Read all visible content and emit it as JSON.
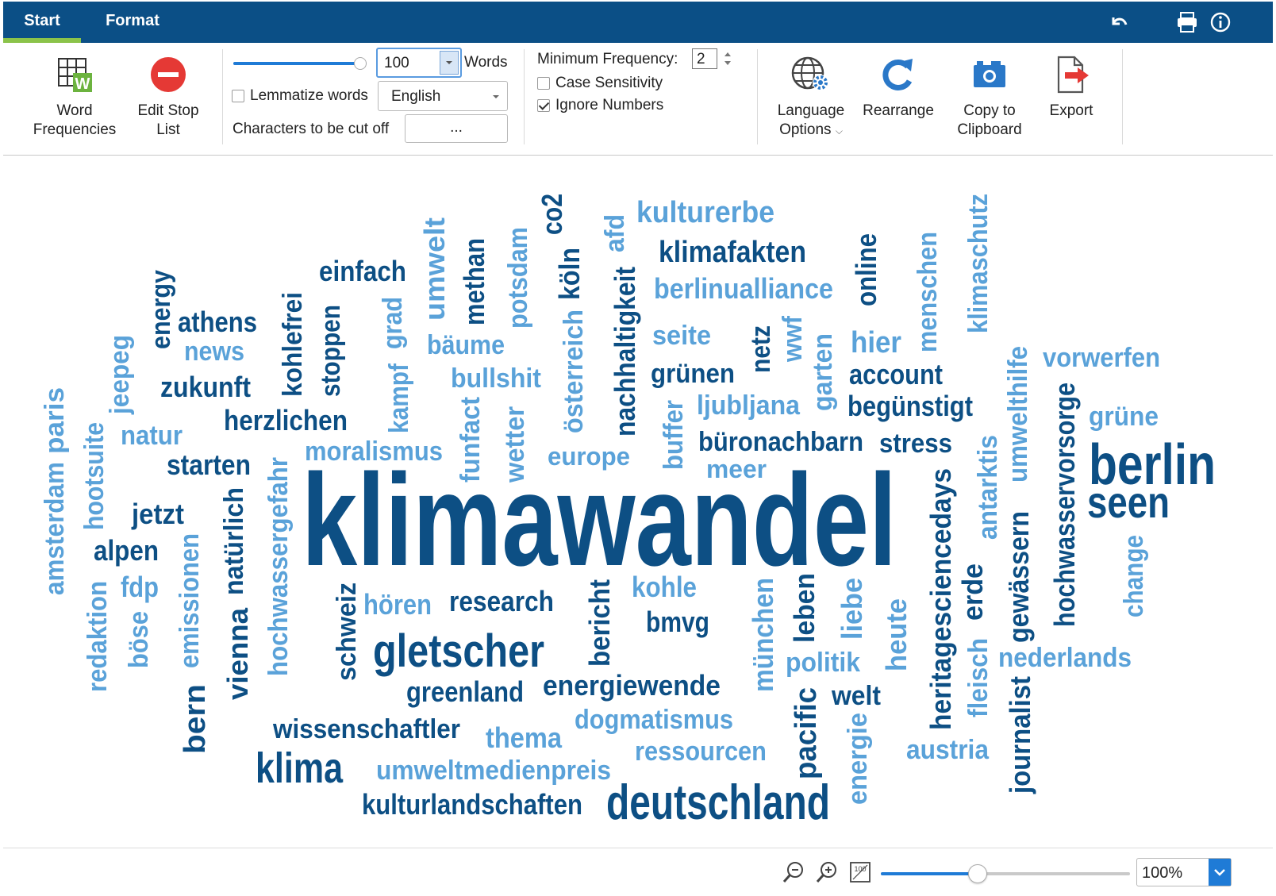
{
  "tabs": [
    {
      "label": "Start",
      "active": true
    },
    {
      "label": "Format",
      "active": false
    }
  ],
  "ribbon": {
    "word_frequencies_line1": "Word",
    "word_frequencies_line2": "Frequencies",
    "edit_stop_list_line1": "Edit Stop",
    "edit_stop_list_line2": "List",
    "words_count": "100",
    "words_label": "Words",
    "words_slider_fraction": 1.0,
    "lemmatize_label": "Lemmatize words",
    "lemmatize_checked": false,
    "language_value": "English",
    "cut_off_label": "Characters to be cut off",
    "cut_off_button": "...",
    "min_freq_label": "Minimum Frequency:",
    "min_freq_value": "2",
    "case_sensitivity_label": "Case Sensitivity",
    "case_sensitivity_checked": false,
    "ignore_numbers_label": "Ignore Numbers",
    "ignore_numbers_checked": true,
    "language_options_line1": "Language",
    "language_options_line2": "Options",
    "rearrange_label": "Rearrange",
    "copy_line1": "Copy to",
    "copy_line2": "Clipboard",
    "export_label": "Export"
  },
  "colors": {
    "brand": "#0b4f86",
    "accent": "#8bc34a",
    "dark_word": "#0d4f84",
    "light_word": "#5aa2d9",
    "stop_red": "#e53935",
    "slider_blue": "#1f7bd6"
  },
  "icons": {
    "undo": "undo-icon",
    "print": "printer-icon",
    "info": "info-icon",
    "word_frequencies": "word-frequencies-icon",
    "edit_stop_list": "stop-sign-icon",
    "language_options": "globe-gear-icon",
    "rearrange": "refresh-icon",
    "copy": "camera-icon",
    "export": "export-icon",
    "zoom_out": "zoom-out-icon",
    "zoom_in": "zoom-in-icon",
    "zoom_100": "zoom-100-icon"
  },
  "cloud_words": [
    {
      "text": "klimawandel",
      "tone": "dark"
    },
    {
      "text": "berlin",
      "tone": "dark"
    },
    {
      "text": "seen",
      "tone": "dark"
    },
    {
      "text": "deutschland",
      "tone": "dark"
    },
    {
      "text": "gletscher",
      "tone": "dark"
    },
    {
      "text": "klima",
      "tone": "dark"
    },
    {
      "text": "kulturerbe",
      "tone": "light"
    },
    {
      "text": "klimafakten",
      "tone": "dark"
    },
    {
      "text": "berlinualliance",
      "tone": "light"
    },
    {
      "text": "einfach",
      "tone": "dark"
    },
    {
      "text": "athens",
      "tone": "dark"
    },
    {
      "text": "news",
      "tone": "light"
    },
    {
      "text": "zukunft",
      "tone": "dark"
    },
    {
      "text": "herzlichen",
      "tone": "dark"
    },
    {
      "text": "natur",
      "tone": "light"
    },
    {
      "text": "starten",
      "tone": "dark"
    },
    {
      "text": "moralismus",
      "tone": "light"
    },
    {
      "text": "bäume",
      "tone": "light"
    },
    {
      "text": "bullshit",
      "tone": "light"
    },
    {
      "text": "europe",
      "tone": "light"
    },
    {
      "text": "seite",
      "tone": "light"
    },
    {
      "text": "grünen",
      "tone": "dark"
    },
    {
      "text": "ljubljana",
      "tone": "light"
    },
    {
      "text": "büronachbarn",
      "tone": "dark"
    },
    {
      "text": "meer",
      "tone": "light"
    },
    {
      "text": "hier",
      "tone": "light"
    },
    {
      "text": "account",
      "tone": "dark"
    },
    {
      "text": "begünstigt",
      "tone": "dark"
    },
    {
      "text": "stress",
      "tone": "dark"
    },
    {
      "text": "vorwerfen",
      "tone": "light"
    },
    {
      "text": "grüne",
      "tone": "light"
    },
    {
      "text": "jetzt",
      "tone": "dark"
    },
    {
      "text": "alpen",
      "tone": "dark"
    },
    {
      "text": "fdp",
      "tone": "light"
    },
    {
      "text": "hören",
      "tone": "light"
    },
    {
      "text": "research",
      "tone": "dark"
    },
    {
      "text": "kohle",
      "tone": "light"
    },
    {
      "text": "bmvg",
      "tone": "dark"
    },
    {
      "text": "politik",
      "tone": "light"
    },
    {
      "text": "welt",
      "tone": "dark"
    },
    {
      "text": "nederlands",
      "tone": "light"
    },
    {
      "text": "greenland",
      "tone": "dark"
    },
    {
      "text": "energiewende",
      "tone": "dark"
    },
    {
      "text": "dogmatismus",
      "tone": "light"
    },
    {
      "text": "wissenschaftler",
      "tone": "dark"
    },
    {
      "text": "thema",
      "tone": "light"
    },
    {
      "text": "ressourcen",
      "tone": "light"
    },
    {
      "text": "austria",
      "tone": "light"
    },
    {
      "text": "umweltmedienpreis",
      "tone": "light"
    },
    {
      "text": "kulturlandschaften",
      "tone": "dark"
    },
    {
      "text": "amsterdam",
      "tone": "light"
    },
    {
      "text": "paris",
      "tone": "light"
    },
    {
      "text": "jeepeg",
      "tone": "light"
    },
    {
      "text": "energy",
      "tone": "dark"
    },
    {
      "text": "hootsuite",
      "tone": "light"
    },
    {
      "text": "redaktion",
      "tone": "light"
    },
    {
      "text": "böse",
      "tone": "light"
    },
    {
      "text": "emissionen",
      "tone": "light"
    },
    {
      "text": "bern",
      "tone": "dark"
    },
    {
      "text": "vienna",
      "tone": "dark"
    },
    {
      "text": "natürlich",
      "tone": "dark"
    },
    {
      "text": "hochwassergefahr",
      "tone": "light"
    },
    {
      "text": "kohlefrei",
      "tone": "dark"
    },
    {
      "text": "stoppen",
      "tone": "dark"
    },
    {
      "text": "kampf",
      "tone": "light"
    },
    {
      "text": "grad",
      "tone": "light"
    },
    {
      "text": "umwelt",
      "tone": "light"
    },
    {
      "text": "methan",
      "tone": "dark"
    },
    {
      "text": "potsdam",
      "tone": "light"
    },
    {
      "text": "co2",
      "tone": "dark"
    },
    {
      "text": "köln",
      "tone": "dark"
    },
    {
      "text": "afd",
      "tone": "light"
    },
    {
      "text": "österreich",
      "tone": "light"
    },
    {
      "text": "nachhaltigkeit",
      "tone": "dark"
    },
    {
      "text": "funfact",
      "tone": "light"
    },
    {
      "text": "wetter",
      "tone": "light"
    },
    {
      "text": "buffer",
      "tone": "light"
    },
    {
      "text": "netz",
      "tone": "dark"
    },
    {
      "text": "wwf",
      "tone": "light"
    },
    {
      "text": "garten",
      "tone": "light"
    },
    {
      "text": "online",
      "tone": "dark"
    },
    {
      "text": "menschen",
      "tone": "light"
    },
    {
      "text": "klimaschutz",
      "tone": "light"
    },
    {
      "text": "umwelthilfe",
      "tone": "light"
    },
    {
      "text": "hochwasservorsorge",
      "tone": "dark"
    },
    {
      "text": "antarktis",
      "tone": "light"
    },
    {
      "text": "heritagesciencedays",
      "tone": "dark"
    },
    {
      "text": "gewässern",
      "tone": "dark"
    },
    {
      "text": "change",
      "tone": "light"
    },
    {
      "text": "erde",
      "tone": "dark"
    },
    {
      "text": "fleisch",
      "tone": "light"
    },
    {
      "text": "journalist",
      "tone": "dark"
    },
    {
      "text": "heute",
      "tone": "light"
    },
    {
      "text": "liebe",
      "tone": "light"
    },
    {
      "text": "leben",
      "tone": "dark"
    },
    {
      "text": "münchen",
      "tone": "light"
    },
    {
      "text": "pacific",
      "tone": "dark"
    },
    {
      "text": "energie",
      "tone": "light"
    },
    {
      "text": "bericht",
      "tone": "dark"
    },
    {
      "text": "schweiz",
      "tone": "dark"
    }
  ],
  "status": {
    "zoom_value": "100%",
    "zoom_fraction": 0.38
  }
}
